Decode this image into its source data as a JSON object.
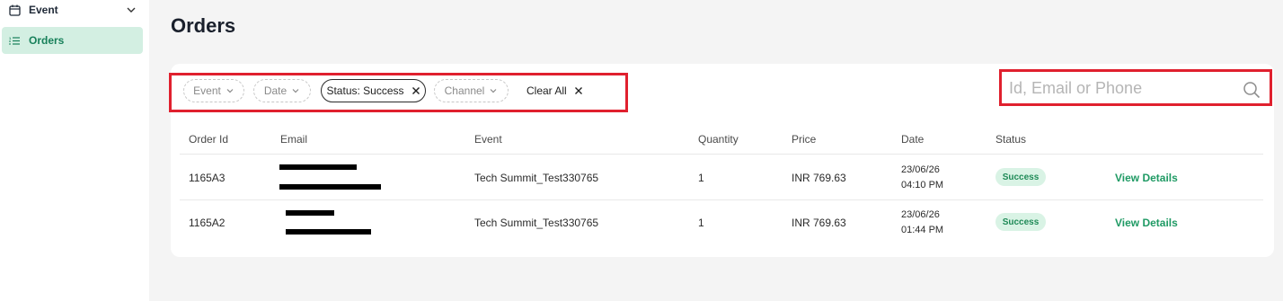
{
  "sidebar": {
    "items": [
      {
        "label": "Event",
        "icon": "calendar-icon"
      },
      {
        "label": "Orders",
        "icon": "list-icon",
        "active": true
      }
    ]
  },
  "page": {
    "title": "Orders"
  },
  "filters": {
    "event": "Event",
    "date": "Date",
    "status": "Status: Success",
    "channel": "Channel",
    "clear_all": "Clear All"
  },
  "search": {
    "placeholder": "Id, Email or Phone",
    "value": ""
  },
  "table": {
    "headers": [
      "Order Id",
      "Email",
      "Event",
      "Quantity",
      "Price",
      "Date",
      "Status"
    ],
    "rows": [
      {
        "order_id": "1165A3",
        "event": "Tech Summit_Test330765",
        "quantity": "1",
        "price": "INR 769.63",
        "date": "23/06/26",
        "time": "04:10 PM",
        "status": "Success",
        "action": "View Details"
      },
      {
        "order_id": "1165A2",
        "event": "Tech Summit_Test330765",
        "quantity": "1",
        "price": "INR 769.63",
        "date": "23/06/26",
        "time": "01:44 PM",
        "status": "Success",
        "action": "View Details"
      }
    ]
  },
  "colors": {
    "accent": "#17805a",
    "highlight_box": "#e0202e",
    "success_bg": "#d9f3e5"
  }
}
